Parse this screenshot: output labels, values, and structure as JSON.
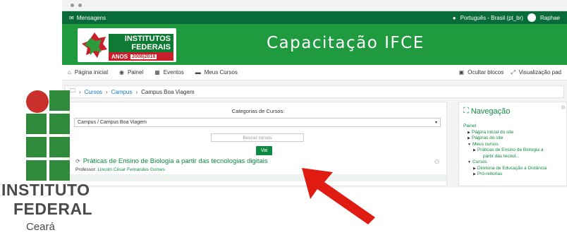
{
  "topbar": {
    "messages_label": "Mensagens",
    "language_label": "Português - Brasil (pt_br)",
    "user_name": "Raphae"
  },
  "banner": {
    "logo_line1": "INSTITUTOS",
    "logo_line2": "FEDERAIS",
    "logo_anos": "ANOS",
    "logo_years": "2008|2018",
    "site_title": "Capacitação IFCE"
  },
  "navbar": {
    "home": "Página inicial",
    "dashboard": "Painel",
    "events": "Eventos",
    "my_courses": "Meus Cursos",
    "hide_blocks": "Ocultar blocos",
    "fullscreen": "Visualização pad"
  },
  "breadcrumb": {
    "courses": "Cursos",
    "campus": "Campus",
    "current": "Campus Boa Viagem"
  },
  "main": {
    "categories_label": "Categorias de Cursos:",
    "category_selected": "Campus / Campus Boa Viagem",
    "search_placeholder": "Buscar cursos",
    "go_button": "Vai",
    "course_title": "Práticas de Ensino de Biologia a partir das tecnologias digitais",
    "teacher_label": "Professor:",
    "teacher_name": "Lincoln César Fernandes Gomes"
  },
  "navigation": {
    "title": "Navegação",
    "root": "Painel",
    "site_home": "Página inicial do site",
    "site_pages": "Páginas do site",
    "my_courses": "Meus cursos",
    "course_line1": "Práticas de Ensino de Biologia a",
    "course_line2": "partir das tecnol...",
    "courses": "Cursos",
    "dir1": "Diretoria de Educação a Distância",
    "dir2": "Pró-reitorias"
  },
  "overlay_logo": {
    "line1": "INSTITUTO",
    "line2": "FEDERAL",
    "line3": "Ceará"
  },
  "colors": {
    "moodle_green": "#0a6b3a",
    "banner_green": "#1f9a3f",
    "link_green": "#0d8a41",
    "if_red": "#c9302c",
    "arrow_red": "#e01b12"
  }
}
